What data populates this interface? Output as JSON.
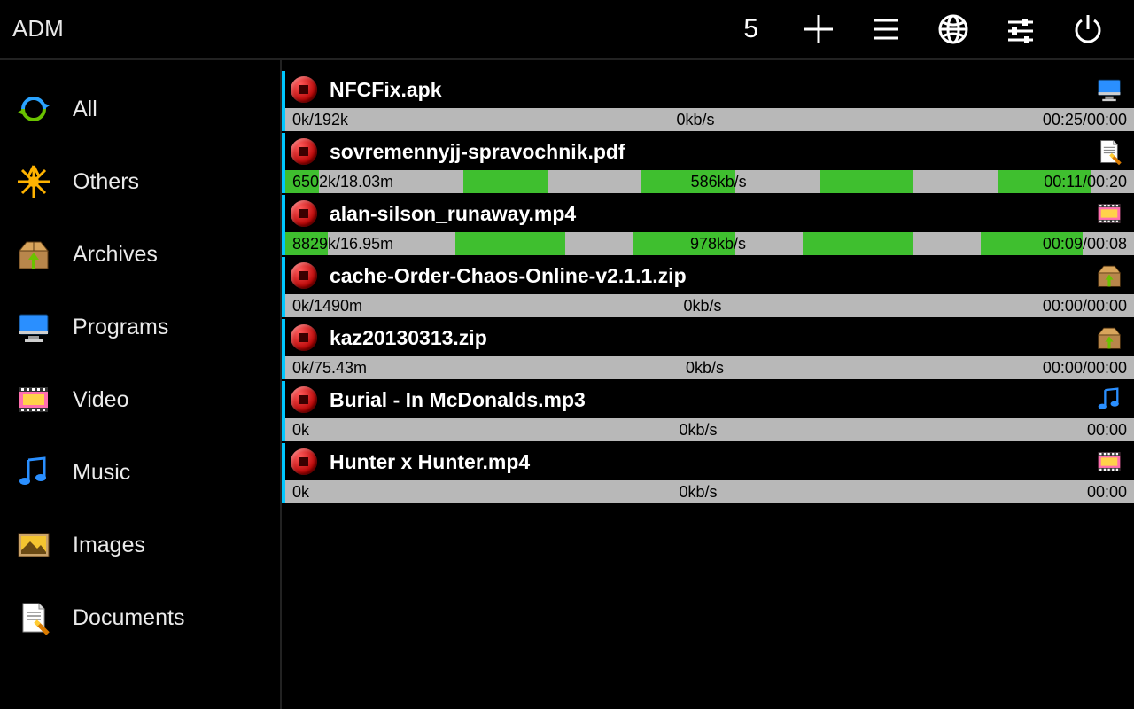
{
  "header": {
    "title": "ADM",
    "count": "5"
  },
  "sidebar": {
    "items": [
      {
        "label": "All",
        "icon": "refresh"
      },
      {
        "label": "Others",
        "icon": "star-burst"
      },
      {
        "label": "Archives",
        "icon": "archive-box"
      },
      {
        "label": "Programs",
        "icon": "monitor"
      },
      {
        "label": "Video",
        "icon": "film"
      },
      {
        "label": "Music",
        "icon": "music-note"
      },
      {
        "label": "Images",
        "icon": "picture"
      },
      {
        "label": "Documents",
        "icon": "document"
      }
    ]
  },
  "downloads": [
    {
      "name": "NFCFix.apk",
      "type": "program",
      "size": "0k/192k",
      "speed": "0kb/s",
      "time": "00:25/00:00",
      "segments": []
    },
    {
      "name": "sovremennyjj-spravochnik.pdf",
      "type": "document",
      "size": "6502k/18.03m",
      "speed": "586kb/s",
      "time": "00:11/00:20",
      "segments": [
        {
          "start": 0,
          "width": 4
        },
        {
          "start": 21,
          "width": 10
        },
        {
          "start": 42,
          "width": 11
        },
        {
          "start": 63,
          "width": 11
        },
        {
          "start": 84,
          "width": 11
        }
      ]
    },
    {
      "name": "alan-silson_runaway.mp4",
      "type": "video",
      "size": "8829k/16.95m",
      "speed": "978kb/s",
      "time": "00:09/00:08",
      "segments": [
        {
          "start": 0,
          "width": 5
        },
        {
          "start": 20,
          "width": 13
        },
        {
          "start": 41,
          "width": 12
        },
        {
          "start": 61,
          "width": 13
        },
        {
          "start": 82,
          "width": 12
        }
      ]
    },
    {
      "name": "cache-Order-Chaos-Online-v2.1.1.zip",
      "type": "archive",
      "size": "0k/1490m",
      "speed": "0kb/s",
      "time": "00:00/00:00",
      "segments": []
    },
    {
      "name": "kaz20130313.zip",
      "type": "archive",
      "size": "0k/75.43m",
      "speed": "0kb/s",
      "time": "00:00/00:00",
      "segments": []
    },
    {
      "name": "Burial - In McDonalds.mp3",
      "type": "music",
      "size": "0k",
      "speed": "0kb/s",
      "time": "00:00",
      "segments": []
    },
    {
      "name": "Hunter x Hunter.mp4",
      "type": "video",
      "size": "0k",
      "speed": "0kb/s",
      "time": "00:00",
      "segments": []
    }
  ]
}
